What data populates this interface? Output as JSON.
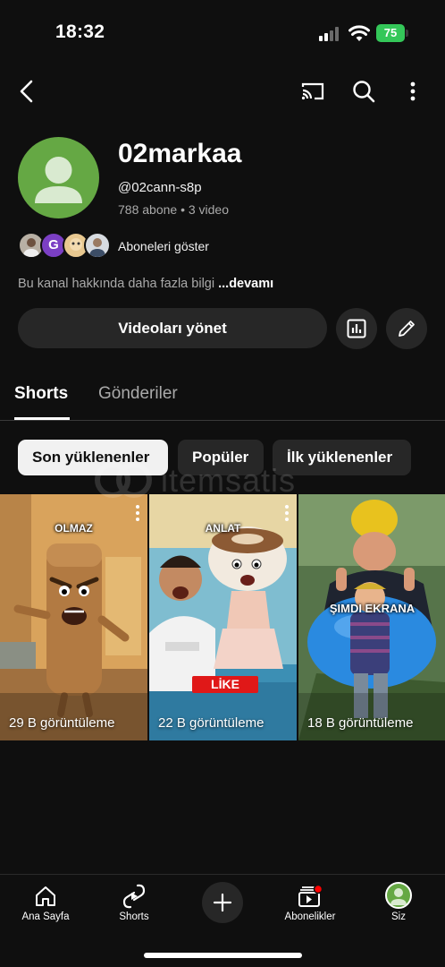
{
  "status_bar": {
    "time": "18:32",
    "battery": "75"
  },
  "channel": {
    "name": "02markaa",
    "handle": "@02cann-s8p",
    "stats": "788 abone • 3 video",
    "show_subscribers": "Aboneleri göster",
    "about_text": "Bu kanal hakkında daha fazla bilgi",
    "about_more": "...devamı",
    "avatar_color": "#65a844"
  },
  "actions": {
    "manage_videos": "Videoları yönet"
  },
  "tabs": [
    {
      "label": "Shorts",
      "active": true
    },
    {
      "label": "Gönderiler",
      "active": false
    }
  ],
  "chips": [
    {
      "label": "Son yüklenenler",
      "active": true
    },
    {
      "label": "Popüler",
      "active": false
    },
    {
      "label": "İlk yüklenenler",
      "active": false
    }
  ],
  "watermark": "itemsatis",
  "shorts": [
    {
      "overlay_text": "OLMAZ",
      "views": "29 B görüntüleme"
    },
    {
      "overlay_text": "ANLAT",
      "badge": "LİKE",
      "views": "22 B görüntüleme"
    },
    {
      "overlay_text": "ŞIMDI EKRANA",
      "views": "18 B görüntüleme"
    }
  ],
  "bottom_nav": [
    {
      "label": "Ana Sayfa",
      "icon": "home-icon"
    },
    {
      "label": "Shorts",
      "icon": "shorts-icon"
    },
    {
      "label": "Abonelikler",
      "icon": "subscriptions-icon"
    },
    {
      "label": "Siz",
      "icon": "profile-avatar"
    }
  ],
  "colors": {
    "background": "#0f0f0f",
    "surface": "#272727",
    "accent_green": "#65a844",
    "notification_red": "#ff0000"
  }
}
